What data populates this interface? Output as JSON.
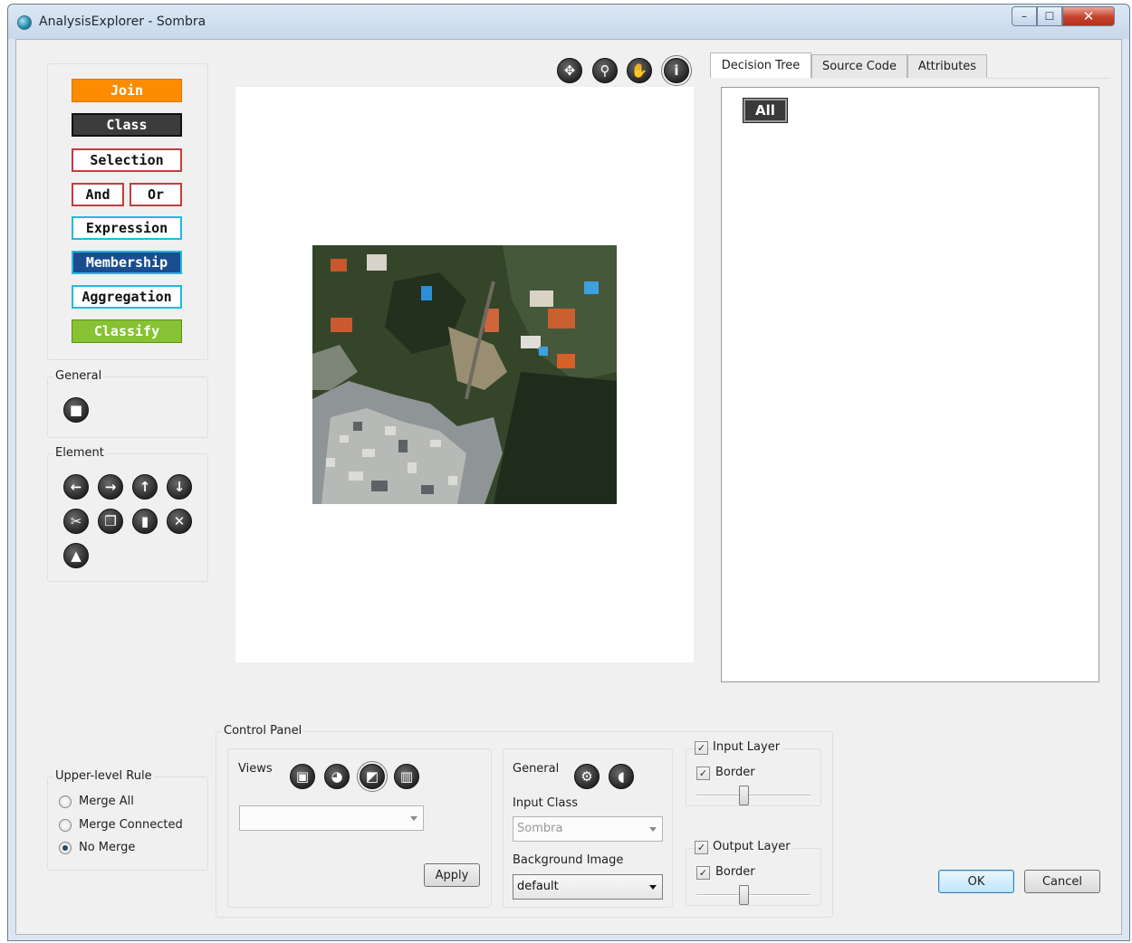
{
  "window": {
    "title": "AnalysisExplorer - Sombra",
    "controls": {
      "minimize": "–",
      "maximize": "☐",
      "close": "✕"
    }
  },
  "toolbox": {
    "buttons": {
      "join": "Join",
      "class": "Class",
      "selection": "Selection",
      "and": "And",
      "or": "Or",
      "expression": "Expression",
      "membership": "Membership",
      "aggregation": "Aggregation",
      "classify": "Classify"
    },
    "colors": {
      "join": "#ff8c00",
      "class": "#3c3c3c",
      "selection": "#c33d3d",
      "expression": "#22b8e0",
      "membership": "#1a4d8f",
      "classify": "#86c232"
    }
  },
  "general_group": {
    "label": "General",
    "icons": [
      "stop-icon"
    ]
  },
  "element_group": {
    "label": "Element",
    "icons": [
      "arrow-left-icon",
      "arrow-right-icon",
      "arrow-up-icon",
      "arrow-down-icon",
      "cut-icon",
      "copy-icon",
      "paste-icon",
      "delete-icon",
      "eject-icon"
    ]
  },
  "canvas_toolbar": {
    "icons": [
      "fit-view-icon",
      "zoom-icon",
      "pan-hand-icon",
      "info-icon"
    ],
    "selected": "info-icon"
  },
  "tabs": {
    "items": [
      "Decision Tree",
      "Source Code",
      "Attributes"
    ],
    "active": "Decision Tree"
  },
  "decision_tree": {
    "root_node": "All"
  },
  "upper_level_rule": {
    "label": "Upper-level Rule",
    "options": [
      "Merge All",
      "Merge Connected",
      "No Merge"
    ],
    "selected": "No Merge"
  },
  "control_panel": {
    "label": "Control Panel",
    "views": {
      "label": "Views",
      "icons": [
        "image-view-icon",
        "color-view-icon",
        "classification-view-icon",
        "chart-view-icon"
      ],
      "selected": "classification-view-icon",
      "dropdown_value": "",
      "apply_button": "Apply"
    },
    "general": {
      "label": "General",
      "icons": [
        "settings-icon",
        "shape-icon"
      ],
      "input_class_label": "Input Class",
      "input_class_value": "Sombra",
      "background_image_label": "Background Image",
      "background_image_value": "default"
    },
    "input_layer": {
      "label": "Input Layer",
      "checked": true,
      "border_label": "Border",
      "border_checked": true,
      "opacity": 0.4
    },
    "output_layer": {
      "label": "Output Layer",
      "checked": true,
      "border_label": "Border",
      "border_checked": true,
      "opacity": 0.4
    }
  },
  "dialog_buttons": {
    "ok": "OK",
    "cancel": "Cancel"
  }
}
